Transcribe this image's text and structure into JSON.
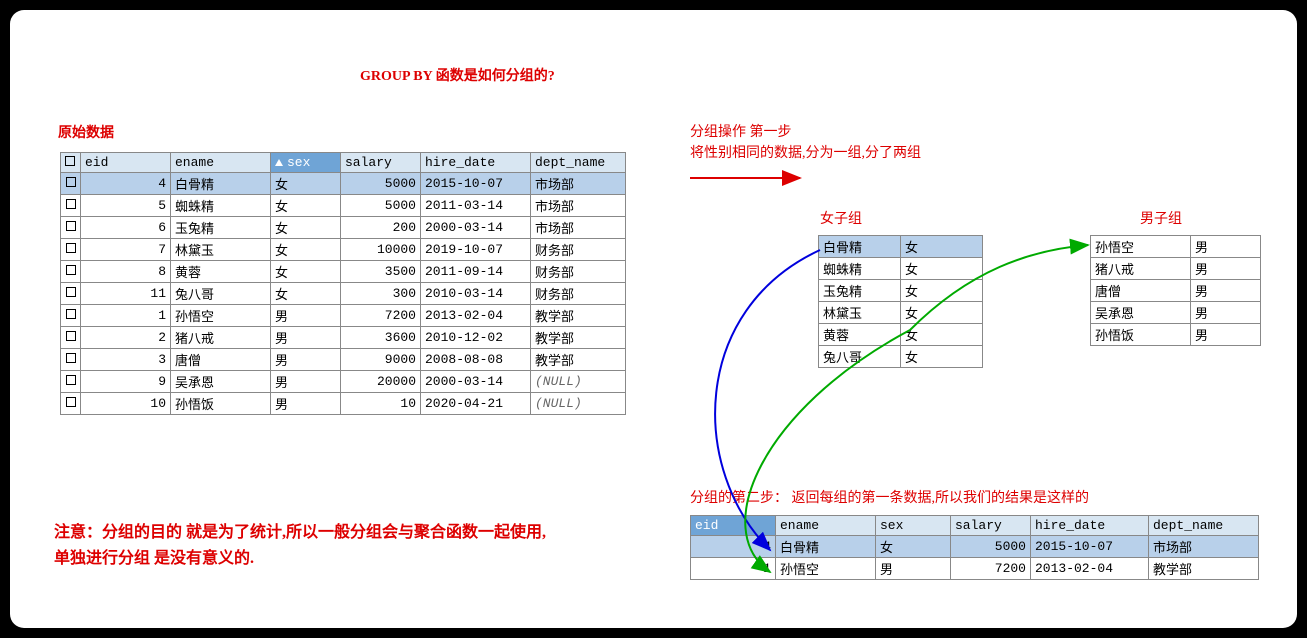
{
  "title": "GROUP BY 函数是如何分组的?",
  "orig_label": "原始数据",
  "note": "注意：分组的目的 就是为了统计,所以一般分组会与聚合函数一起使用,单独进行分组 是没有意义的.",
  "step1_line1": "分组操作 第一步",
  "step1_line2": "将性别相同的数据,分为一组,分了两组",
  "step2": "分组的第二步： 返回每组的第一条数据,所以我们的结果是这样的",
  "female_label": "女子组",
  "male_label": "男子组",
  "headers": {
    "eid": "eid",
    "ename": "ename",
    "sex": "sex",
    "salary": "salary",
    "hire_date": "hire_date",
    "dept_name": "dept_name"
  },
  "main_rows": [
    {
      "eid": "4",
      "ename": "白骨精",
      "sex": "女",
      "salary": "5000",
      "hire_date": "2015-10-07",
      "dept": "市场部",
      "sel": true
    },
    {
      "eid": "5",
      "ename": "蜘蛛精",
      "sex": "女",
      "salary": "5000",
      "hire_date": "2011-03-14",
      "dept": "市场部"
    },
    {
      "eid": "6",
      "ename": "玉兔精",
      "sex": "女",
      "salary": "200",
      "hire_date": "2000-03-14",
      "dept": "市场部"
    },
    {
      "eid": "7",
      "ename": "林黛玉",
      "sex": "女",
      "salary": "10000",
      "hire_date": "2019-10-07",
      "dept": "财务部"
    },
    {
      "eid": "8",
      "ename": "黄蓉",
      "sex": "女",
      "salary": "3500",
      "hire_date": "2011-09-14",
      "dept": "财务部"
    },
    {
      "eid": "11",
      "ename": "兔八哥",
      "sex": "女",
      "salary": "300",
      "hire_date": "2010-03-14",
      "dept": "财务部"
    },
    {
      "eid": "1",
      "ename": "孙悟空",
      "sex": "男",
      "salary": "7200",
      "hire_date": "2013-02-04",
      "dept": "教学部"
    },
    {
      "eid": "2",
      "ename": "猪八戒",
      "sex": "男",
      "salary": "3600",
      "hire_date": "2010-12-02",
      "dept": "教学部"
    },
    {
      "eid": "3",
      "ename": "唐僧",
      "sex": "男",
      "salary": "9000",
      "hire_date": "2008-08-08",
      "dept": "教学部"
    },
    {
      "eid": "9",
      "ename": "吴承恩",
      "sex": "男",
      "salary": "20000",
      "hire_date": "2000-03-14",
      "dept": "(NULL)",
      "null": true
    },
    {
      "eid": "10",
      "ename": "孙悟饭",
      "sex": "男",
      "salary": "10",
      "hire_date": "2020-04-21",
      "dept": "(NULL)",
      "null": true
    }
  ],
  "female_rows": [
    {
      "ename": "白骨精",
      "sex": "女",
      "sel": true
    },
    {
      "ename": "蜘蛛精",
      "sex": "女"
    },
    {
      "ename": "玉兔精",
      "sex": "女"
    },
    {
      "ename": "林黛玉",
      "sex": "女"
    },
    {
      "ename": "黄蓉",
      "sex": "女"
    },
    {
      "ename": "兔八哥",
      "sex": "女"
    }
  ],
  "male_rows": [
    {
      "ename": "孙悟空",
      "sex": "男"
    },
    {
      "ename": "猪八戒",
      "sex": "男"
    },
    {
      "ename": "唐僧",
      "sex": "男"
    },
    {
      "ename": "吴承恩",
      "sex": "男"
    },
    {
      "ename": "孙悟饭",
      "sex": "男"
    }
  ],
  "result_rows": [
    {
      "eid": "4",
      "ename": "白骨精",
      "sex": "女",
      "salary": "5000",
      "hire_date": "2015-10-07",
      "dept": "市场部",
      "sel": true
    },
    {
      "eid": "1",
      "ename": "孙悟空",
      "sex": "男",
      "salary": "7200",
      "hire_date": "2013-02-04",
      "dept": "教学部"
    }
  ]
}
